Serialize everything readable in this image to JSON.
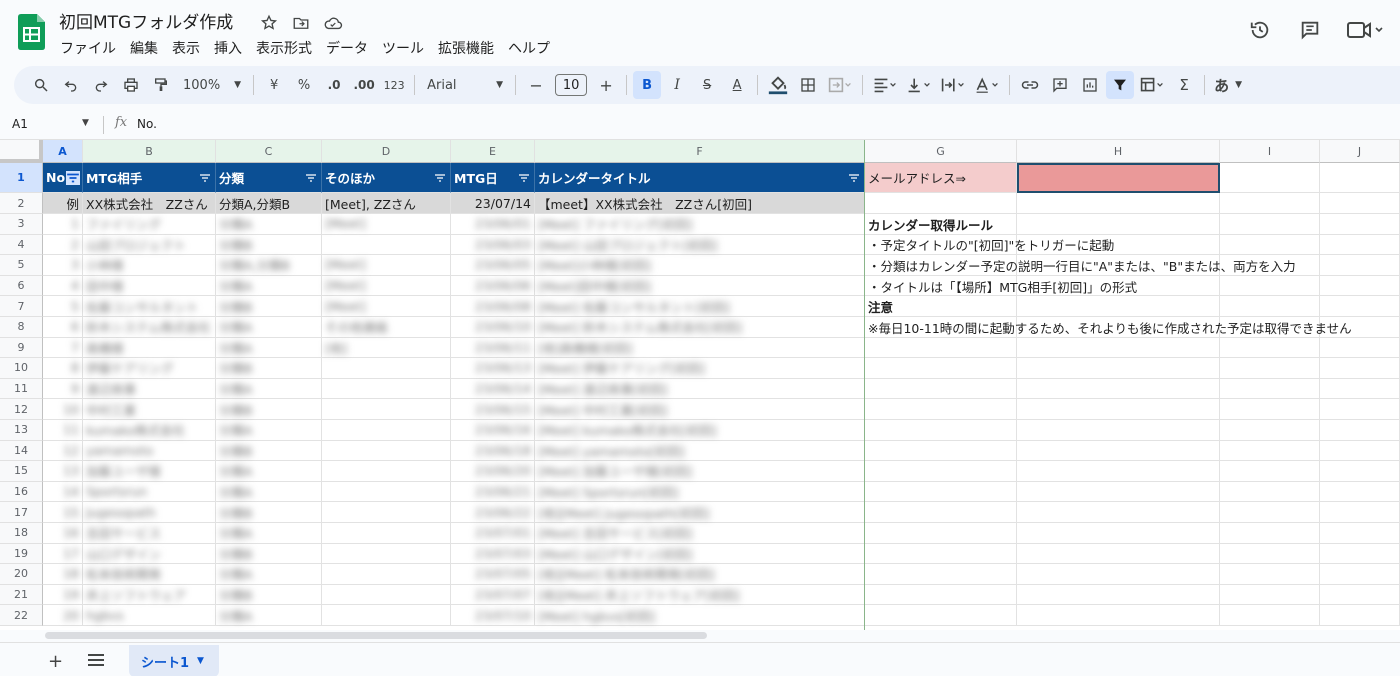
{
  "app": {
    "title": "初回MTGフォルダ作成",
    "menu": [
      "ファイル",
      "編集",
      "表示",
      "挿入",
      "表示形式",
      "データ",
      "ツール",
      "拡張機能",
      "ヘルプ"
    ],
    "brand_color": "#0f9d58"
  },
  "toolbar": {
    "zoom": "100%",
    "currency": "¥",
    "percent": "%",
    "dec_decrease": ".0",
    "dec_increase": ".00",
    "number_format": "123",
    "font": "Arial",
    "font_size": "10",
    "minus": "−",
    "plus": "+",
    "bold": "B",
    "italic": "I",
    "strike": "S",
    "text_color": "A",
    "functions": "Σ",
    "input_tools": "あ"
  },
  "formula_bar": {
    "cell_ref": "A1",
    "fx": "fx",
    "value": "No."
  },
  "columns": [
    "A",
    "B",
    "C",
    "D",
    "E",
    "F",
    "G",
    "H",
    "I",
    "J"
  ],
  "rows": [
    "1",
    "2",
    "3",
    "4",
    "5",
    "6",
    "7",
    "8",
    "9",
    "10",
    "11",
    "12",
    "13",
    "14",
    "15",
    "16",
    "17",
    "18",
    "19",
    "20",
    "21",
    "22"
  ],
  "table": {
    "headers": [
      "No",
      "MTG相手",
      "分類",
      "そのほか",
      "MTG日",
      "カレンダータイトル"
    ],
    "example_row": [
      "例",
      "XX株式会社　ZZさん",
      "分類A,分類B",
      "[Meet], ZZさん",
      "23/07/14",
      "【meet】XX株式会社　ZZさん[初回]"
    ],
    "blurred_rows": [
      [
        "1",
        "ファイリング",
        "分類A",
        "[Meet]",
        "23/06/01",
        "[Meet] ファイリング[初回]"
      ],
      [
        "2",
        "山田プロジェクト",
        "分類B",
        "",
        "23/06/03",
        "[Meet] 山田プロジェクト[初回]"
      ],
      [
        "3",
        "小林様",
        "分類A,分類B",
        "[Meet]",
        "23/06/05",
        "[Meet]小林様[初回]"
      ],
      [
        "4",
        "田中様",
        "分類A",
        "[Meet]",
        "23/06/06",
        "[Meet]田中様[初回]"
      ],
      [
        "5",
        "佐藤コンサルタント",
        "分類B",
        "[Meet]",
        "23/06/08",
        "[Meet] 佐藤コンサルタント[初回]"
      ],
      [
        "6",
        "鈴木システム株式会社",
        "分類A",
        "その他連絡",
        "23/06/10",
        "[Meet] 鈴木システム株式会社[初回]"
      ],
      [
        "7",
        "高橋様",
        "分類A",
        "[他]",
        "23/06/11",
        "[他]高橋様[初回]"
      ],
      [
        "8",
        "伊藤ケアリング",
        "分類B",
        "",
        "23/06/13",
        "[Meet] 伊藤ケアリング[初回]"
      ],
      [
        "9",
        "渡辺商事",
        "分類A",
        "",
        "23/06/14",
        "[Meet] 渡辺商事[初回]"
      ],
      [
        "10",
        "中村工業",
        "分類B",
        "",
        "23/06/15",
        "[Meet] 中村工業[初回]"
      ],
      [
        "11",
        "kumako株式会社",
        "分類A",
        "",
        "23/06/16",
        "[Meet] kumako株式会社[初回]"
      ],
      [
        "12",
        "yamamoto",
        "分類B",
        "",
        "23/06/18",
        "[Meet] yamamoto[初回]"
      ],
      [
        "13",
        "加藤ユーザ様",
        "分類A",
        "",
        "23/06/20",
        "[Meet] 加藤ユーザ様[初回]"
      ],
      [
        "14",
        "Sportsrun",
        "分類A",
        "",
        "23/06/21",
        "[Meet] Sportsrun[初回]"
      ],
      [
        "15",
        "Jugesopath",
        "分類B",
        "",
        "23/06/22",
        "[他][Meet] Jugesopath[初回]"
      ],
      [
        "16",
        "吉田サービス",
        "分類A",
        "",
        "23/07/01",
        "[Meet] 吉田サービス[初回]"
      ],
      [
        "17",
        "山口デザイン",
        "分類B",
        "",
        "23/07/03",
        "[Meet] 山口デザイン[初回]"
      ],
      [
        "18",
        "松本技術開発",
        "分類A",
        "",
        "23/07/05",
        "[他][Meet] 松本技術開発[初回]"
      ],
      [
        "19",
        "井上ソフトウェア",
        "分類B",
        "",
        "23/07/07",
        "[他][Meet] 井上ソフトウェア[初回]"
      ],
      [
        "20",
        "hgbvs",
        "分類A",
        "",
        "23/07/10",
        "[Meet] hgbvs[初回]"
      ]
    ]
  },
  "side_panel": {
    "email_label": "メールアドレス⇒",
    "email_value": "",
    "rules_title": "カレンダー取得ルール",
    "rule1": "・予定タイトルの\"[初回]\"をトリガーに起動",
    "rule2": "・分類はカレンダー予定の説明一行目に\"A\"または、\"B\"または、両方を入力",
    "rule3": "・タイトルは「【場所】MTG相手[初回]」の形式",
    "note_title": "注意",
    "note": "※毎日10-11時の間に起動するため、それよりも後に作成された予定は取得できません"
  },
  "sheets": {
    "tabs": [
      "シート1"
    ],
    "add_label": "+"
  },
  "colors": {
    "header_blue": "#0b4f94",
    "example_gray": "#d9d9d9",
    "email_label_bg": "#f4cccc",
    "email_input_bg": "#ea9999",
    "accent_blue": "#0b57d0"
  }
}
